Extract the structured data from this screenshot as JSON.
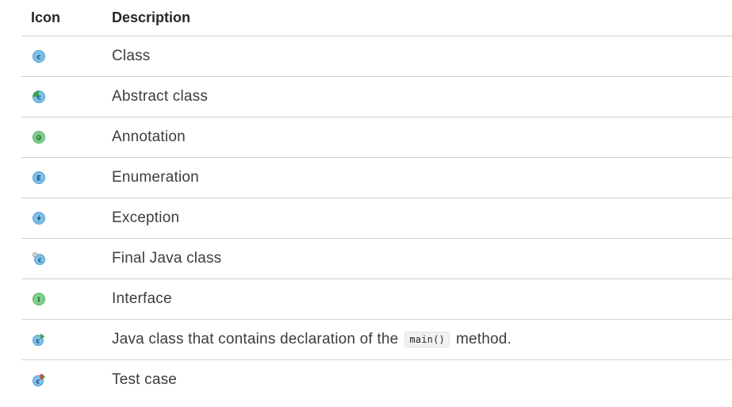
{
  "header": {
    "icon_col": "Icon",
    "description_col": "Description"
  },
  "rows": [
    {
      "icon": "class-icon",
      "description": "Class"
    },
    {
      "icon": "abstract-class-icon",
      "description": "Abstract class"
    },
    {
      "icon": "annotation-icon",
      "description": "Annotation"
    },
    {
      "icon": "enumeration-icon",
      "description": "Enumeration"
    },
    {
      "icon": "exception-icon",
      "description": "Exception"
    },
    {
      "icon": "final-class-icon",
      "description": "Final Java class"
    },
    {
      "icon": "interface-icon",
      "description": "Interface"
    },
    {
      "icon": "main-class-icon",
      "description_before": "Java class that contains declaration of the",
      "code": "main()",
      "description_after": "method."
    },
    {
      "icon": "test-case-icon",
      "description": "Test case"
    }
  ],
  "colors": {
    "class_blue": "#7fc0e8",
    "interface_green": "#7fd18f",
    "annotation_green": "#5fbf6f",
    "play_green": "#3fa24f",
    "test_red": "#e0453a",
    "border": "#d1d1d2"
  }
}
